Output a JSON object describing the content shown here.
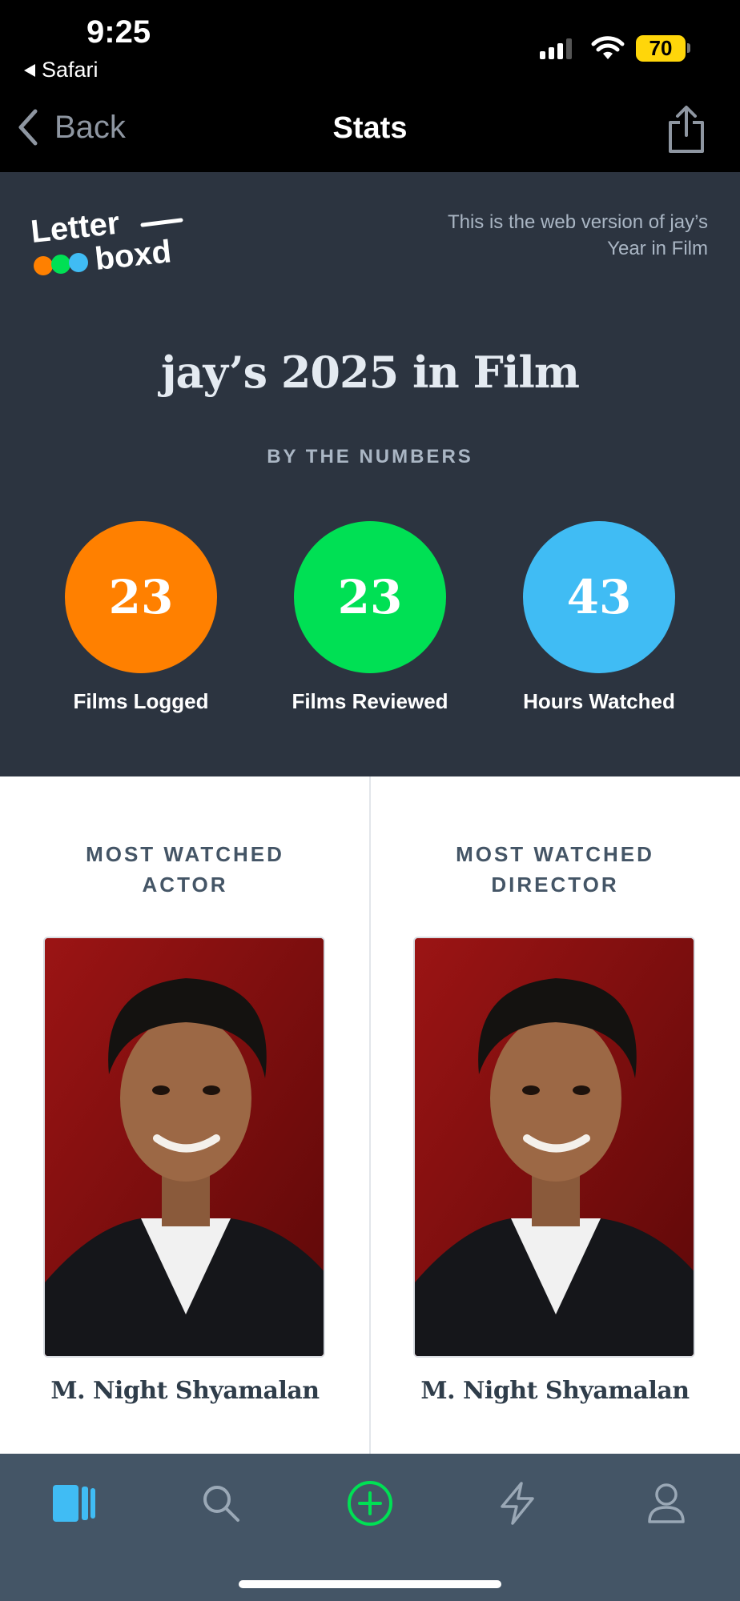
{
  "status_bar": {
    "time": "9:25",
    "back_app": "Safari",
    "battery": "70",
    "colors": {
      "battery": "#ffd60a"
    }
  },
  "nav": {
    "back_label": "Back",
    "title": "Stats",
    "icons": {
      "back": "chevron-left-icon",
      "share": "share-icon"
    }
  },
  "header": {
    "logo_text": "Letterboxd",
    "web_note": "This is the web version of jay’s Year in Film",
    "title": "jay’s 2025 in Film",
    "subtitle": "BY THE NUMBERS",
    "background": "#2c3440"
  },
  "stats": [
    {
      "value": "23",
      "label": "Films Logged",
      "color": "#ff8000"
    },
    {
      "value": "23",
      "label": "Films Reviewed",
      "color": "#00e054"
    },
    {
      "value": "43",
      "label": "Hours Watched",
      "color": "#40bcf4"
    }
  ],
  "people": {
    "actor": {
      "heading": "MOST WATCHED ACTOR",
      "name": "M. Night Shyamalan"
    },
    "director": {
      "heading": "MOST WATCHED DIRECTOR",
      "name": "M. Night Shyamalan"
    }
  },
  "tab_bar": {
    "tabs": [
      {
        "icon": "films-icon",
        "active": true
      },
      {
        "icon": "search-icon",
        "active": false
      },
      {
        "icon": "add-icon",
        "active": false
      },
      {
        "icon": "activity-icon",
        "active": false
      },
      {
        "icon": "profile-icon",
        "active": false
      }
    ],
    "colors": {
      "active": "#40bcf4",
      "add": "#00e054",
      "inactive": "#9aa8b6"
    }
  }
}
